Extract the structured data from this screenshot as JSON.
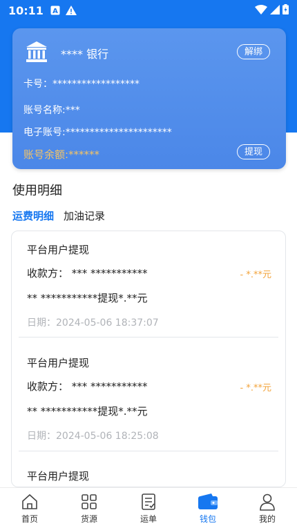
{
  "status_bar": {
    "time": "10:11"
  },
  "card": {
    "bank_name": "**** 银行",
    "unbind_label": "解绑",
    "card_no": "卡号：******************",
    "account_name": "账号名称:***",
    "e_account": "电子账号:**********************",
    "balance": "账号余额:******",
    "withdraw_label": "提现"
  },
  "section": {
    "title": "使用明细"
  },
  "tabs": [
    {
      "label": "运费明细"
    },
    {
      "label": "加油记录"
    }
  ],
  "records": [
    {
      "title": "平台用户提现",
      "payee": "收款方：  *** ***********",
      "amount": "- *.**元",
      "remark": "** ***********提现*.**元",
      "date": "日期：2024-05-06 18:37:07"
    },
    {
      "title": "平台用户提现",
      "payee": "收款方：  *** ***********",
      "amount": "- *.**元",
      "remark": "** ***********提现*.**元",
      "date": "日期：2024-05-06 18:25:08"
    },
    {
      "title": "平台用户提现"
    }
  ],
  "bottom_nav": [
    {
      "label": "首页",
      "icon": "home-icon"
    },
    {
      "label": "货源",
      "icon": "grid-icon"
    },
    {
      "label": "运单",
      "icon": "waybill-icon"
    },
    {
      "label": "钱包",
      "icon": "wallet-icon",
      "active": true
    },
    {
      "label": "我的",
      "icon": "user-icon"
    }
  ],
  "colors": {
    "primary": "#1677f0",
    "amount": "#f2a33a",
    "balance": "#f4c465"
  }
}
